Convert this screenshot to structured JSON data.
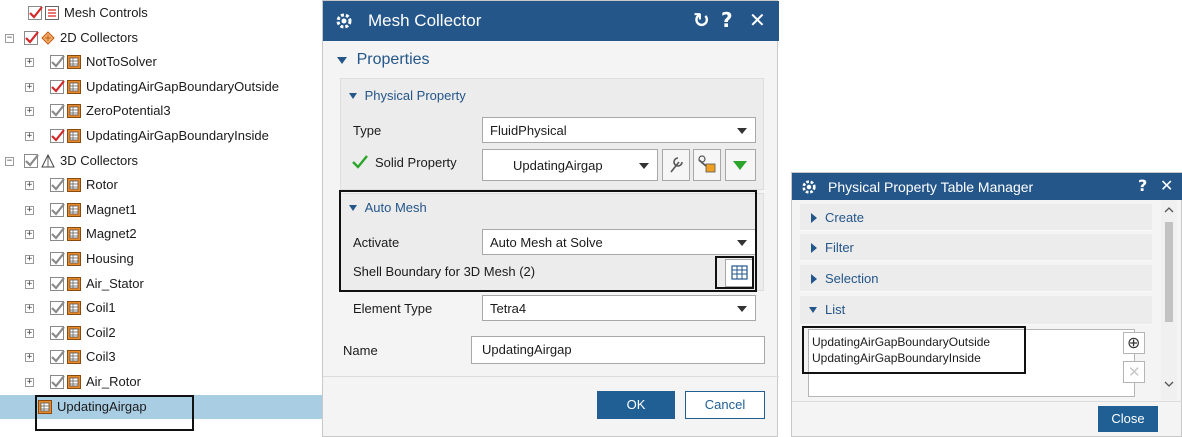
{
  "tree": {
    "items": [
      {
        "label": "Mesh Controls",
        "checked": true,
        "check_color": "#d62828",
        "icon": "mesh-controls-icon"
      },
      {
        "label": "2D Collectors",
        "checked": true,
        "check_color": "#d62828",
        "icon": "2d-collector-icon",
        "expander": "−"
      },
      {
        "label": "NotToSolver",
        "checked": true,
        "check_color": "#8a8a8a",
        "icon": "mesh-collector-icon",
        "expander": "+"
      },
      {
        "label": "UpdatingAirGapBoundaryOutside",
        "checked": true,
        "check_color": "#d62828",
        "icon": "mesh-collector-icon",
        "expander": "+"
      },
      {
        "label": "ZeroPotential3",
        "checked": true,
        "check_color": "#8a8a8a",
        "icon": "mesh-collector-icon",
        "expander": "+"
      },
      {
        "label": "UpdatingAirGapBoundaryInside",
        "checked": true,
        "check_color": "#d62828",
        "icon": "mesh-collector-icon",
        "expander": "+"
      },
      {
        "label": "3D Collectors",
        "checked": true,
        "check_color": "#8a8a8a",
        "icon": "3d-collector-icon",
        "expander": "−"
      },
      {
        "label": "Rotor",
        "checked": true,
        "check_color": "#8a8a8a",
        "icon": "mesh-collector-icon",
        "expander": "+"
      },
      {
        "label": "Magnet1",
        "checked": true,
        "check_color": "#8a8a8a",
        "icon": "mesh-collector-icon",
        "expander": "+"
      },
      {
        "label": "Magnet2",
        "checked": true,
        "check_color": "#8a8a8a",
        "icon": "mesh-collector-icon",
        "expander": "+"
      },
      {
        "label": "Housing",
        "checked": true,
        "check_color": "#8a8a8a",
        "icon": "mesh-collector-icon",
        "expander": "+"
      },
      {
        "label": "Air_Stator",
        "checked": true,
        "check_color": "#8a8a8a",
        "icon": "mesh-collector-icon",
        "expander": "+"
      },
      {
        "label": "Coil1",
        "checked": true,
        "check_color": "#8a8a8a",
        "icon": "mesh-collector-icon",
        "expander": "+"
      },
      {
        "label": "Coil2",
        "checked": true,
        "check_color": "#8a8a8a",
        "icon": "mesh-collector-icon",
        "expander": "+"
      },
      {
        "label": "Coil3",
        "checked": true,
        "check_color": "#8a8a8a",
        "icon": "mesh-collector-icon",
        "expander": "+"
      },
      {
        "label": "Air_Rotor",
        "checked": true,
        "check_color": "#8a8a8a",
        "icon": "mesh-collector-icon",
        "expander": "+"
      },
      {
        "label": "UpdatingAirgap",
        "checked": false,
        "icon": "mesh-collector-icon",
        "selected": true
      }
    ]
  },
  "mesh_dialog": {
    "title": "Mesh Collector",
    "reset_glyph": "↻",
    "help_glyph": "?",
    "close_glyph": "✕",
    "properties_label": "Properties",
    "physical_property": {
      "header": "Physical Property",
      "type_label": "Type",
      "type_value": "FluidPhysical",
      "solid_label": "Solid Property",
      "solid_value": "UpdatingAirgap"
    },
    "auto_mesh": {
      "header": "Auto Mesh",
      "activate_label": "Activate",
      "activate_value": "Auto Mesh at Solve",
      "shell_label": "Shell Boundary for 3D Mesh (2)"
    },
    "element_type_label": "Element Type",
    "element_type_value": "Tetra4",
    "name_label": "Name",
    "name_value": "UpdatingAirgap",
    "ok_label": "OK",
    "cancel_label": "Cancel"
  },
  "ppm": {
    "title": "Physical Property Table Manager",
    "help_glyph": "?",
    "close_glyph": "✕",
    "sections": [
      "Create",
      "Filter",
      "Selection",
      "List"
    ],
    "list_items": [
      "UpdatingAirGapBoundaryOutside",
      "UpdatingAirGapBoundaryInside"
    ],
    "add_glyph": "⊕",
    "remove_glyph": "✕",
    "close_label": "Close"
  },
  "colors": {
    "title_bar": "#24568a",
    "accent_text": "#24568a",
    "primary_button": "#1f5f94",
    "selected_row": "#a9cde3",
    "check_red": "#d62828",
    "check_green": "#2aa52a"
  }
}
